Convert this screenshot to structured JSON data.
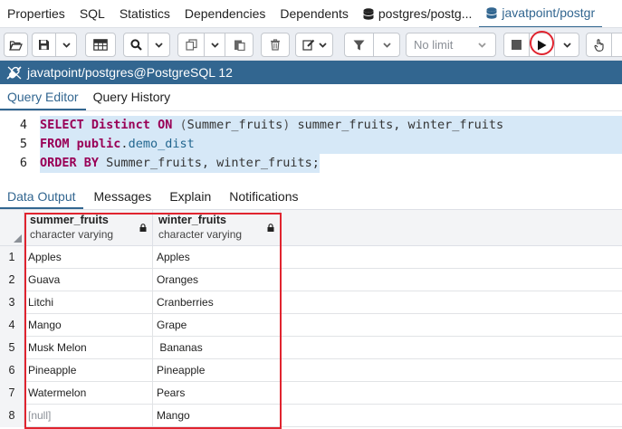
{
  "tabs": [
    {
      "label": "Properties",
      "icon": null
    },
    {
      "label": "SQL",
      "icon": null
    },
    {
      "label": "Statistics",
      "icon": null
    },
    {
      "label": "Dependencies",
      "icon": null
    },
    {
      "label": "Dependents",
      "icon": null
    },
    {
      "label": "postgres/postg...",
      "icon": "database-icon"
    },
    {
      "label": "javatpoint/postgr",
      "icon": "database-icon"
    }
  ],
  "toolbar": {
    "limit_label": "No limit"
  },
  "connection": {
    "label": "javatpoint/postgres@PostgreSQL 12"
  },
  "editor_tabs": [
    "Query Editor",
    "Query History"
  ],
  "code_lines": [
    {
      "num": "4",
      "parts": [
        [
          "kw",
          "SELECT "
        ],
        [
          "kw",
          "Distinct "
        ],
        [
          "kw",
          "ON "
        ],
        [
          "paren",
          "("
        ],
        [
          "id",
          "Summer_fruits"
        ],
        [
          "paren",
          ")"
        ],
        [
          "id",
          " summer_fruits, winter_fruits"
        ]
      ]
    },
    {
      "num": "5",
      "parts": [
        [
          "kw",
          "FROM "
        ],
        [
          "kw",
          "public"
        ],
        [
          "id",
          "."
        ],
        [
          "prop",
          "demo_dist"
        ]
      ]
    },
    {
      "num": "6",
      "parts": [
        [
          "kw",
          "ORDER "
        ],
        [
          "kw",
          "BY "
        ],
        [
          "id",
          "Summer_fruits, winter_fruits;"
        ]
      ]
    }
  ],
  "output_tabs": [
    "Data Output",
    "Messages",
    "Explain",
    "Notifications"
  ],
  "columns": [
    {
      "name": "summer_fruits",
      "type": "character varying"
    },
    {
      "name": "winter_fruits",
      "type": "character varying"
    }
  ],
  "rows": [
    {
      "num": "1",
      "summer": "Apples",
      "winter": "Apples"
    },
    {
      "num": "2",
      "summer": "Guava",
      "winter": "Oranges"
    },
    {
      "num": "3",
      "summer": "Litchi",
      "winter": "Cranberries"
    },
    {
      "num": "4",
      "summer": "Mango",
      "winter": "Grape"
    },
    {
      "num": "5",
      "summer": "Musk Melon",
      "winter": " Bananas"
    },
    {
      "num": "6",
      "summer": "Pineapple",
      "winter": "Pineapple"
    },
    {
      "num": "7",
      "summer": "Watermelon",
      "winter": "Pears"
    },
    {
      "num": "8",
      "summer": "[null]",
      "winter": "Mango"
    }
  ],
  "colors": {
    "accent": "#326690",
    "highlight": "#e0242f",
    "selection": "#d6e8f7",
    "keyword": "#990056"
  }
}
